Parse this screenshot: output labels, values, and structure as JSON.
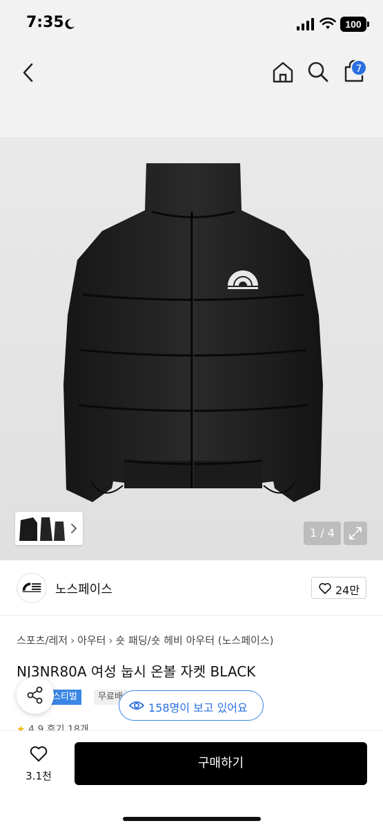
{
  "status_bar": {
    "time": "7:35",
    "battery": "100"
  },
  "nav": {
    "cart_count": "7"
  },
  "gallery": {
    "counter": "1 / 4"
  },
  "brand": {
    "name": "노스페이스",
    "likes": "24만"
  },
  "breadcrumb": [
    "스포츠/레저",
    "아우터",
    "숏 패딩/숏 헤비 아우터 (노스페이스)"
  ],
  "product": {
    "title": "NJ3NR80A 여성 눕시 온볼 자켓 BLACK",
    "tag_festival": "페스티벌",
    "tag_free": "무료배",
    "viewers": "158명이 보고 있어요",
    "rating": "4.9",
    "reviews": "후기 18개"
  },
  "bottom": {
    "wish_count": "3.1천",
    "buy_label": "구매하기"
  },
  "colors": {
    "accent": "#2a6fe0",
    "buy": "#000000",
    "header_bg": "#f2f2f2"
  }
}
